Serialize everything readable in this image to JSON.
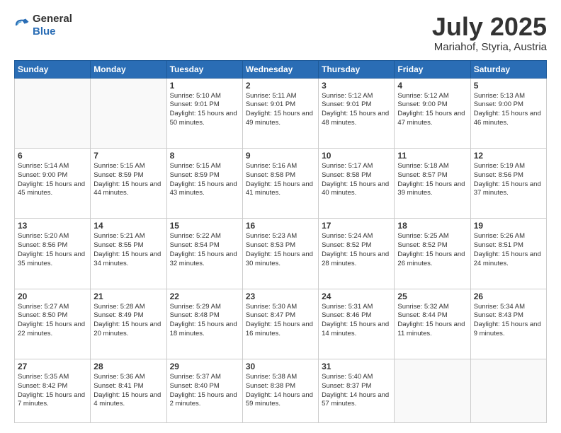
{
  "logo": {
    "general": "General",
    "blue": "Blue"
  },
  "header": {
    "month": "July 2025",
    "location": "Mariahof, Styria, Austria"
  },
  "weekdays": [
    "Sunday",
    "Monday",
    "Tuesday",
    "Wednesday",
    "Thursday",
    "Friday",
    "Saturday"
  ],
  "weeks": [
    [
      {
        "day": "",
        "empty": true
      },
      {
        "day": "",
        "empty": true
      },
      {
        "day": "1",
        "sunrise": "5:10 AM",
        "sunset": "9:01 PM",
        "daylight": "15 hours and 50 minutes."
      },
      {
        "day": "2",
        "sunrise": "5:11 AM",
        "sunset": "9:01 PM",
        "daylight": "15 hours and 49 minutes."
      },
      {
        "day": "3",
        "sunrise": "5:12 AM",
        "sunset": "9:01 PM",
        "daylight": "15 hours and 48 minutes."
      },
      {
        "day": "4",
        "sunrise": "5:12 AM",
        "sunset": "9:00 PM",
        "daylight": "15 hours and 47 minutes."
      },
      {
        "day": "5",
        "sunrise": "5:13 AM",
        "sunset": "9:00 PM",
        "daylight": "15 hours and 46 minutes."
      }
    ],
    [
      {
        "day": "6",
        "sunrise": "5:14 AM",
        "sunset": "9:00 PM",
        "daylight": "15 hours and 45 minutes."
      },
      {
        "day": "7",
        "sunrise": "5:15 AM",
        "sunset": "8:59 PM",
        "daylight": "15 hours and 44 minutes."
      },
      {
        "day": "8",
        "sunrise": "5:15 AM",
        "sunset": "8:59 PM",
        "daylight": "15 hours and 43 minutes."
      },
      {
        "day": "9",
        "sunrise": "5:16 AM",
        "sunset": "8:58 PM",
        "daylight": "15 hours and 41 minutes."
      },
      {
        "day": "10",
        "sunrise": "5:17 AM",
        "sunset": "8:58 PM",
        "daylight": "15 hours and 40 minutes."
      },
      {
        "day": "11",
        "sunrise": "5:18 AM",
        "sunset": "8:57 PM",
        "daylight": "15 hours and 39 minutes."
      },
      {
        "day": "12",
        "sunrise": "5:19 AM",
        "sunset": "8:56 PM",
        "daylight": "15 hours and 37 minutes."
      }
    ],
    [
      {
        "day": "13",
        "sunrise": "5:20 AM",
        "sunset": "8:56 PM",
        "daylight": "15 hours and 35 minutes."
      },
      {
        "day": "14",
        "sunrise": "5:21 AM",
        "sunset": "8:55 PM",
        "daylight": "15 hours and 34 minutes."
      },
      {
        "day": "15",
        "sunrise": "5:22 AM",
        "sunset": "8:54 PM",
        "daylight": "15 hours and 32 minutes."
      },
      {
        "day": "16",
        "sunrise": "5:23 AM",
        "sunset": "8:53 PM",
        "daylight": "15 hours and 30 minutes."
      },
      {
        "day": "17",
        "sunrise": "5:24 AM",
        "sunset": "8:52 PM",
        "daylight": "15 hours and 28 minutes."
      },
      {
        "day": "18",
        "sunrise": "5:25 AM",
        "sunset": "8:52 PM",
        "daylight": "15 hours and 26 minutes."
      },
      {
        "day": "19",
        "sunrise": "5:26 AM",
        "sunset": "8:51 PM",
        "daylight": "15 hours and 24 minutes."
      }
    ],
    [
      {
        "day": "20",
        "sunrise": "5:27 AM",
        "sunset": "8:50 PM",
        "daylight": "15 hours and 22 minutes."
      },
      {
        "day": "21",
        "sunrise": "5:28 AM",
        "sunset": "8:49 PM",
        "daylight": "15 hours and 20 minutes."
      },
      {
        "day": "22",
        "sunrise": "5:29 AM",
        "sunset": "8:48 PM",
        "daylight": "15 hours and 18 minutes."
      },
      {
        "day": "23",
        "sunrise": "5:30 AM",
        "sunset": "8:47 PM",
        "daylight": "15 hours and 16 minutes."
      },
      {
        "day": "24",
        "sunrise": "5:31 AM",
        "sunset": "8:46 PM",
        "daylight": "15 hours and 14 minutes."
      },
      {
        "day": "25",
        "sunrise": "5:32 AM",
        "sunset": "8:44 PM",
        "daylight": "15 hours and 11 minutes."
      },
      {
        "day": "26",
        "sunrise": "5:34 AM",
        "sunset": "8:43 PM",
        "daylight": "15 hours and 9 minutes."
      }
    ],
    [
      {
        "day": "27",
        "sunrise": "5:35 AM",
        "sunset": "8:42 PM",
        "daylight": "15 hours and 7 minutes."
      },
      {
        "day": "28",
        "sunrise": "5:36 AM",
        "sunset": "8:41 PM",
        "daylight": "15 hours and 4 minutes."
      },
      {
        "day": "29",
        "sunrise": "5:37 AM",
        "sunset": "8:40 PM",
        "daylight": "15 hours and 2 minutes."
      },
      {
        "day": "30",
        "sunrise": "5:38 AM",
        "sunset": "8:38 PM",
        "daylight": "14 hours and 59 minutes."
      },
      {
        "day": "31",
        "sunrise": "5:40 AM",
        "sunset": "8:37 PM",
        "daylight": "14 hours and 57 minutes."
      },
      {
        "day": "",
        "empty": true
      },
      {
        "day": "",
        "empty": true
      }
    ]
  ]
}
